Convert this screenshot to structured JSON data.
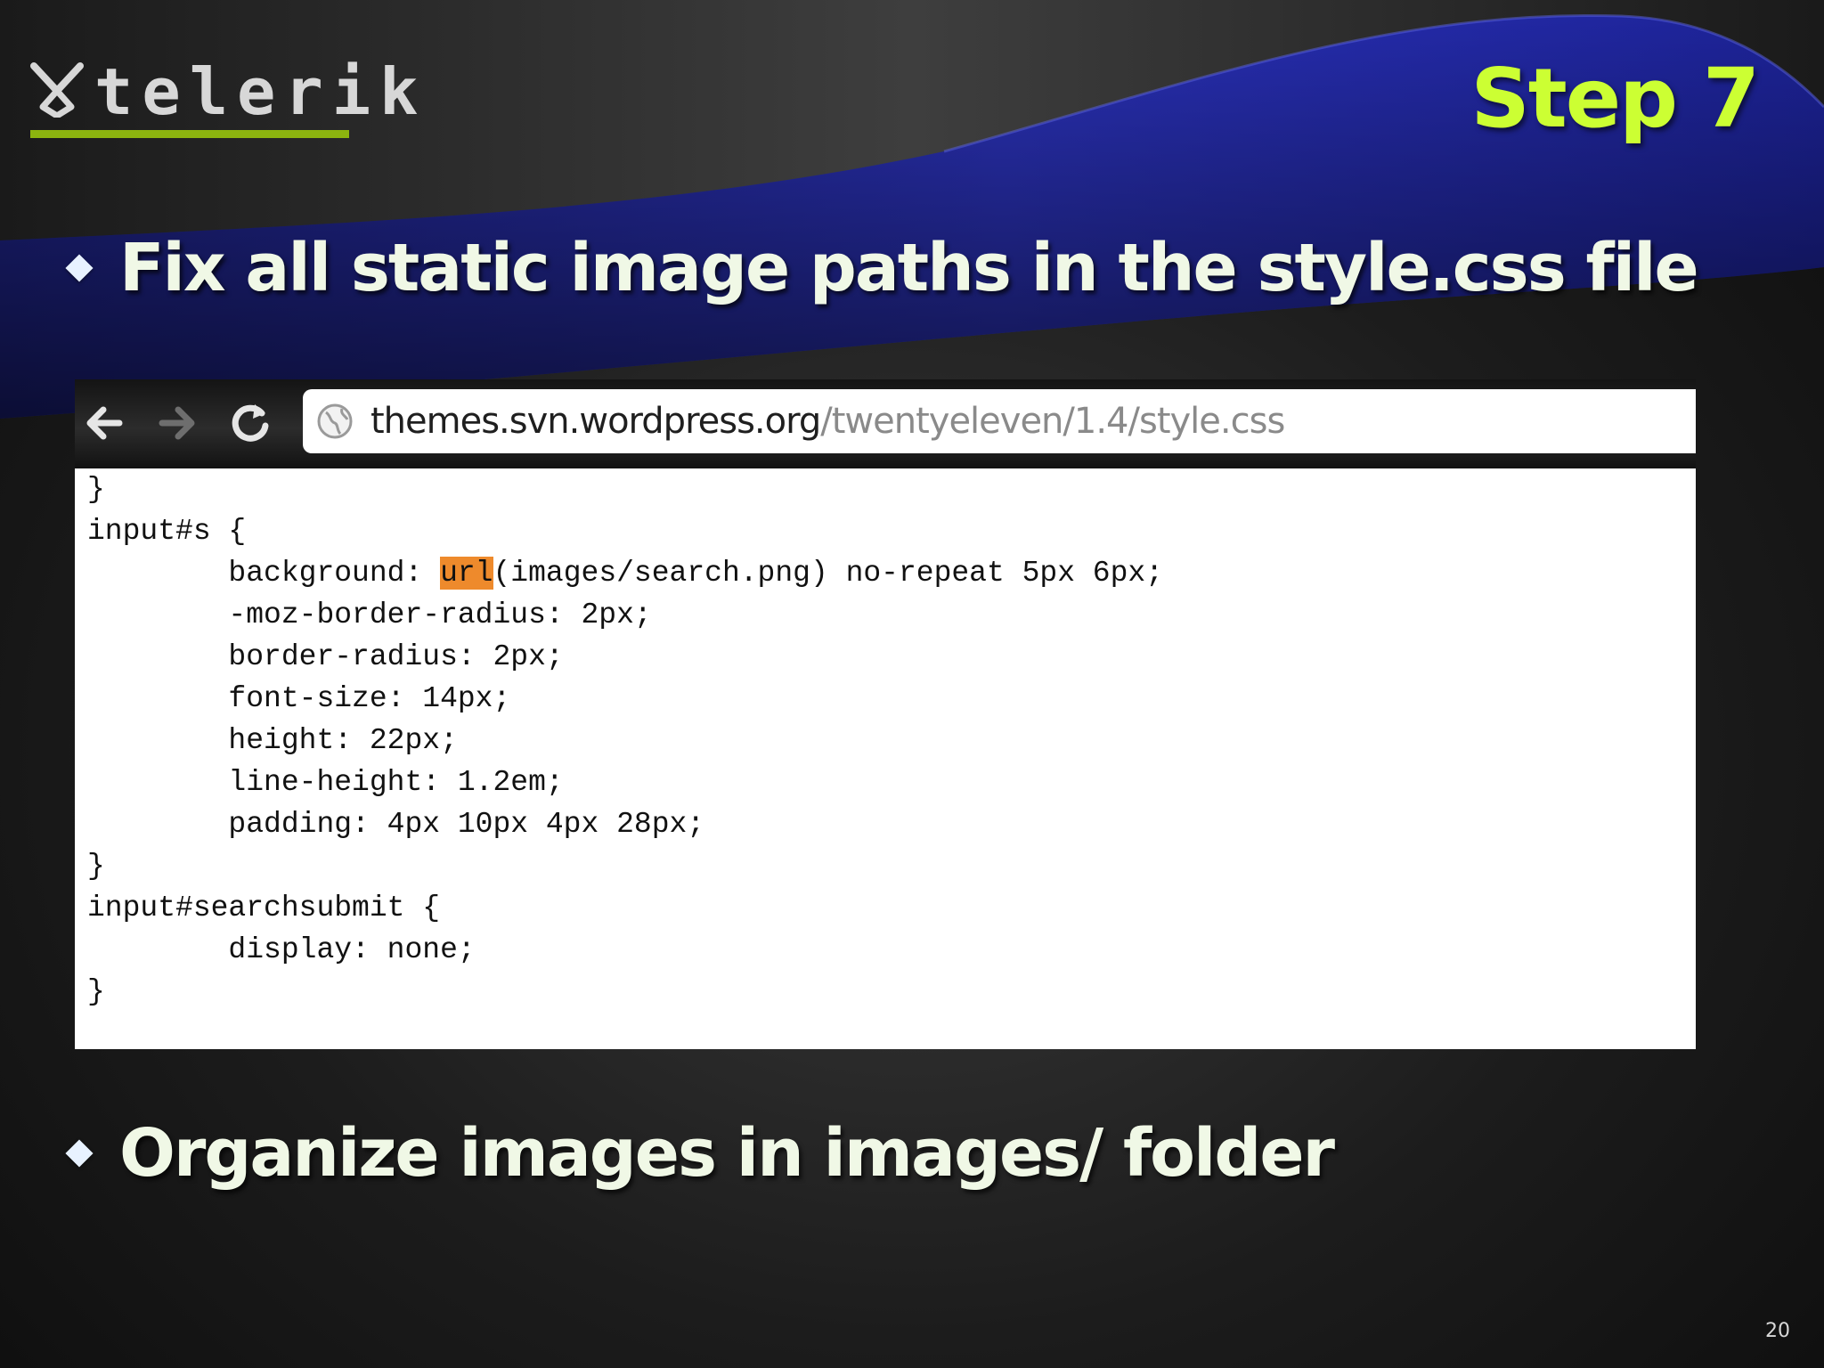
{
  "logo": {
    "text": "telerik",
    "accent_color": "#8cb40f"
  },
  "slide": {
    "title": "Step 7",
    "title_color": "#ccff33",
    "number": "20"
  },
  "bullets": [
    "Fix all static image paths in the style.css file",
    "Organize images in images/ folder"
  ],
  "browser": {
    "url_host": "themes.svn.wordpress.org",
    "url_path": "/twentyeleven/1.4/style.css",
    "icons": [
      "back-arrow-icon",
      "forward-arrow-icon",
      "reload-icon",
      "globe-icon"
    ]
  },
  "code": {
    "highlight_color": "#ee8a2c",
    "lines": [
      "}",
      "input#s {",
      "        background: ",
      "        -moz-border-radius: 2px;",
      "        border-radius: 2px;",
      "        font-size: 14px;",
      "        height: 22px;",
      "        line-height: 1.2em;",
      "        padding: 4px 10px 4px 28px;",
      "}",
      "input#searchsubmit {",
      "        display: none;",
      "}"
    ],
    "highlighted_token": "url",
    "background_rest": "(images/search.png) no-repeat 5px 6px;"
  }
}
